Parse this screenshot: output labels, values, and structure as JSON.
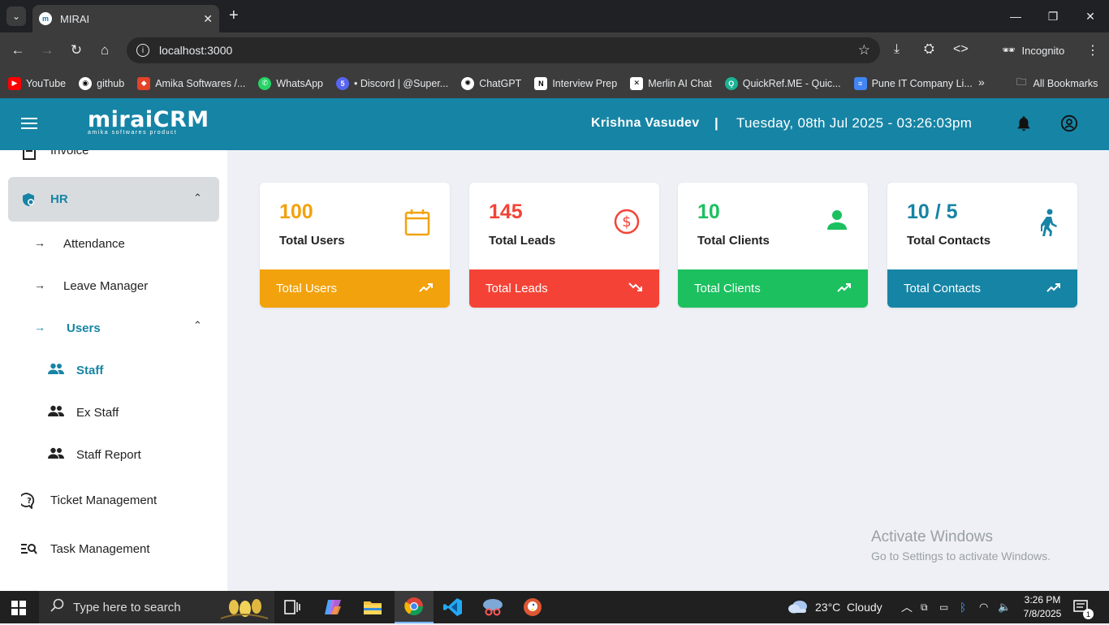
{
  "browser": {
    "tab_title": "MIRAI",
    "url": "localhost:3000",
    "incognito_label": "Incognito",
    "bookmarks": [
      {
        "label": "YouTube",
        "color": "#ff0000",
        "icon": "youtube-icon"
      },
      {
        "label": "github",
        "color": "#ffffff",
        "icon": "github-icon"
      },
      {
        "label": "Amika Softwares /...",
        "color": "#e24329",
        "icon": "gitlab-icon"
      },
      {
        "label": "WhatsApp",
        "color": "#25d366",
        "icon": "whatsapp-icon"
      },
      {
        "label": "• Discord | @Super...",
        "color": "#5865f2",
        "icon": "discord-icon"
      },
      {
        "label": "ChatGPT",
        "color": "#ffffff",
        "icon": "chatgpt-icon"
      },
      {
        "label": "Interview Prep",
        "color": "#ffffff",
        "icon": "notion-icon"
      },
      {
        "label": "Merlin AI Chat",
        "color": "#ffffff",
        "icon": "merlin-icon"
      },
      {
        "label": "QuickRef.ME - Quic...",
        "color": "#1ab394",
        "icon": "quickref-icon"
      },
      {
        "label": "Pune IT Company Li...",
        "color": "#4285f4",
        "icon": "docs-icon"
      }
    ],
    "all_bookmarks_label": "All Bookmarks"
  },
  "header": {
    "logo_text": "miraiCRM",
    "logo_sub": "amika softwares product",
    "user_name": "Krishna Vasudev",
    "separator": "|",
    "datetime": "Tuesday, 08th Jul 2025 - 03:26:03pm"
  },
  "sidebar": {
    "invoice": "Invoice",
    "hr": "HR",
    "attendance": "Attendance",
    "leave_manager": "Leave Manager",
    "users": "Users",
    "staff": "Staff",
    "ex_staff": "Ex Staff",
    "staff_report": "Staff Report",
    "ticket_management": "Ticket Management",
    "task_management": "Task Management"
  },
  "cards": [
    {
      "value": "100",
      "label": "Total Users",
      "footer": "Total Users",
      "color": "#f2a20c",
      "icon": "calendar-icon",
      "trend": "up"
    },
    {
      "value": "145",
      "label": "Total Leads",
      "footer": "Total Leads",
      "color": "#f44336",
      "icon": "dollar-icon",
      "trend": "down"
    },
    {
      "value": "10",
      "label": "Total Clients",
      "footer": "Total Clients",
      "color": "#1cc05f",
      "icon": "person-icon",
      "trend": "up"
    },
    {
      "value": "10 / 5",
      "label": "Total Contacts",
      "footer": "Total Contacts",
      "color": "#1684a5",
      "icon": "walking-icon",
      "trend": "up"
    }
  ],
  "watermark": {
    "title": "Activate Windows",
    "subtitle": "Go to Settings to activate Windows."
  },
  "taskbar": {
    "search_placeholder": "Type here to search",
    "weather": "23°C  Cloudy",
    "time": "3:26 PM",
    "date": "7/8/2025",
    "notification_count": "1"
  }
}
